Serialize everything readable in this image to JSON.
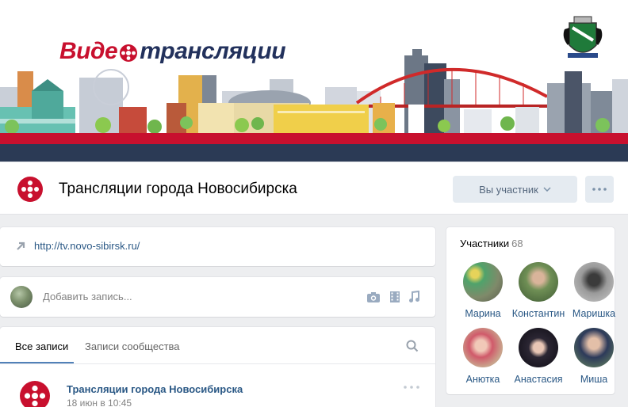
{
  "banner": {
    "title_part1": "Виде",
    "title_part2": "трансляции"
  },
  "group": {
    "name": "Трансляции города Новосибирска",
    "member_button": "Вы участник"
  },
  "link": {
    "url": "http://tv.novo-sibirsk.ru/"
  },
  "composer": {
    "placeholder": "Добавить запись..."
  },
  "feed": {
    "tabs": [
      {
        "label": "Все записи"
      },
      {
        "label": "Записи сообщества"
      }
    ],
    "post": {
      "author": "Трансляции города Новосибирска",
      "date": "18 июн в 10:45"
    }
  },
  "members": {
    "label": "Участники",
    "count": "68",
    "list": [
      {
        "name": "Марина"
      },
      {
        "name": "Константин"
      },
      {
        "name": "Маришка"
      },
      {
        "name": "Анютка"
      },
      {
        "name": "Анастасия"
      },
      {
        "name": "Миша"
      }
    ]
  },
  "colors": {
    "brand_red": "#c8102e",
    "brand_navy": "#2b3a55",
    "link_blue": "#2a5885",
    "accent_blue": "#5181b8"
  }
}
